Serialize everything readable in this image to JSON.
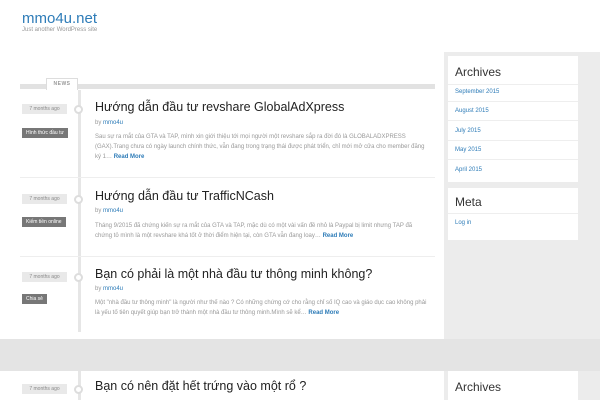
{
  "site": {
    "title": "mmo4u.net",
    "description": "Just another WordPress site"
  },
  "news_tab": "NEWS",
  "posts": [
    {
      "date": "7 months ago",
      "category": "Hình thức đầu tư",
      "title": "Hướng dẫn đầu tư revshare GlobalAdXpress",
      "by": "by",
      "author": "mmo4u",
      "excerpt": "Sau sự ra mắt của GTA và TAP, mình xin giới thiệu tới mọi người một revshare sắp ra đời đó là GLOBALADXPRESS (GAX).Trang chưa có ngày launch chính thức, vẫn đang trong trạng thái được phát triển, chỉ mới mở cửa cho member đăng ký 1…",
      "read_more": "Read More"
    },
    {
      "date": "7 months ago",
      "category": "Kiếm tiền online",
      "title": "Hướng dẫn đầu tư TrafficNCash",
      "by": "by",
      "author": "mmo4u",
      "excerpt": "Tháng 9/2015 đã chứng kiến sự ra mắt của GTA và TAP, mặc dù có một vài vấn đề nhỏ là Paypal bị limit nhưng TAP đã chứng tỏ mình là một revshare khá tốt ở thời điểm hiện tại, còn GTA vẫn đang loay…",
      "read_more": "Read More"
    },
    {
      "date": "7 months ago",
      "category": "Chia sẻ",
      "title": "Bạn có phải là một nhà đầu tư thông minh không?",
      "by": "by",
      "author": "mmo4u",
      "excerpt": "Một \"nhà đầu tư thông minh\" là người như thế nào ? Có những chứng cớ cho rằng chỉ số IQ cao và giáo dục cao không phải là yếu tố tiên quyết giúp bạn trở thành một nhà đầu tư thông minh.Mình sẽ kể…",
      "read_more": "Read More"
    },
    {
      "date": "7 months ago",
      "title": "Bạn có nên đặt hết trứng vào một rổ ?"
    }
  ],
  "sidebar": {
    "archives_title": "Archives",
    "archives": [
      "September 2015",
      "August 2015",
      "July 2015",
      "May 2015",
      "April 2015"
    ],
    "meta_title": "Meta",
    "meta": [
      "Log in"
    ],
    "archives_title_2": "Archives"
  },
  "colors": {
    "link": "#2e7cb8",
    "category_bg": "#777777",
    "background": "#ececec"
  }
}
